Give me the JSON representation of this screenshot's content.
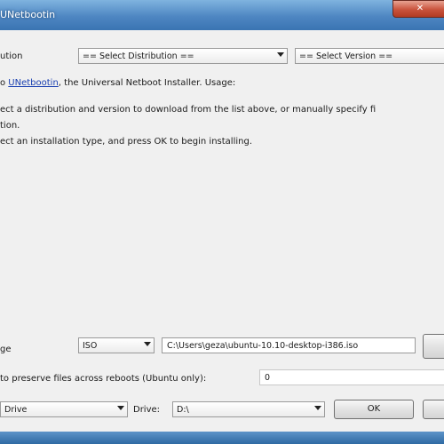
{
  "window": {
    "title": "UNetbootin",
    "close_glyph": "✕"
  },
  "distribution": {
    "label": "ution",
    "selected": "== Select Distribution ==",
    "version_selected": "== Select Version =="
  },
  "intro": {
    "prefix": "o ",
    "link_text": "UNetbootin",
    "suffix": ", the Universal Netboot Installer. Usage:"
  },
  "instructions": {
    "line1": "ect a distribution and version to download from the list above, or manually specify fi",
    "line2": "tion.",
    "line3": "ect an installation type, and press OK to begin installing."
  },
  "diskimage": {
    "label": "ge",
    "type_selected": "ISO",
    "path": "C:\\Users\\geza\\ubuntu-10.10-desktop-i386.iso"
  },
  "persist": {
    "label": "to preserve files across reboots (Ubuntu only):",
    "value": "0"
  },
  "target": {
    "type_selected": "Drive",
    "drive_label": "Drive:",
    "drive_selected": "D:\\"
  },
  "buttons": {
    "ok": "OK"
  }
}
